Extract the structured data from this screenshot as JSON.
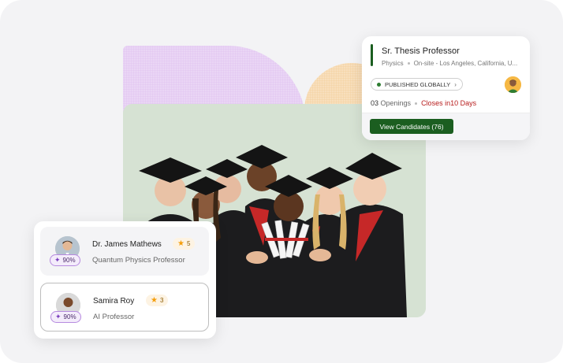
{
  "job": {
    "title": "Sr. Thesis Professor",
    "department": "Physics",
    "work_mode": "On-site",
    "location_separator": "-",
    "location": "Los Angeles, California, U...",
    "status": "PUBLISHED GLOBALLY",
    "openings_count": "03",
    "openings_label": "Openings",
    "closes": "Closes in10 Days",
    "view_button": "View Candidates (76)",
    "accent_color": "#1b5e20"
  },
  "candidates": [
    {
      "name": "Dr. James  Mathews",
      "rating": "5",
      "role": "Quantum Physics Professor",
      "match": "90%"
    },
    {
      "name": "Samira Roy",
      "rating": "3",
      "role": "AI Professor",
      "match": "90%"
    }
  ],
  "icons": {
    "star": "star-icon",
    "sparkle": "sparkle-icon",
    "chevron": "chevron-right-icon"
  }
}
